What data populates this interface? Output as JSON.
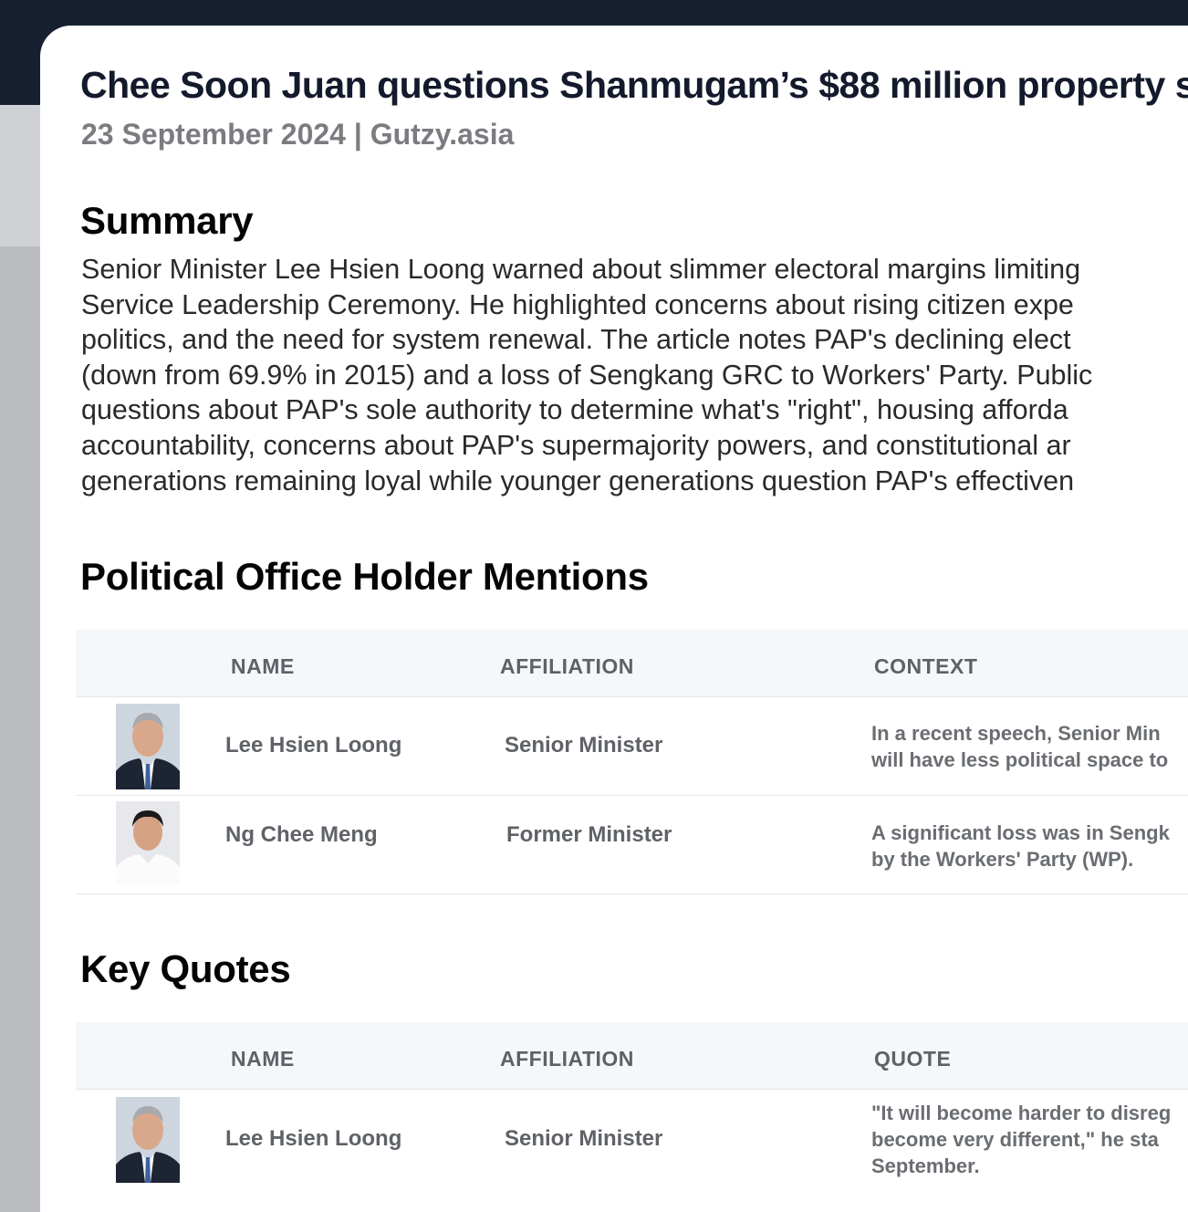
{
  "article": {
    "title": "Chee Soon Juan questions Shanmugam’s $88 million property s",
    "meta": "23 September 2024 | Gutzy.asia"
  },
  "summary": {
    "heading": "Summary",
    "lines": [
      "Senior Minister Lee Hsien Loong warned about slimmer electoral margins limiting",
      "Service Leadership Ceremony. He highlighted concerns about rising citizen expe",
      "politics, and the need for system renewal. The article notes PAP's declining elect",
      "(down from 69.9% in 2015) and a loss of Sengkang GRC to Workers' Party. Public",
      "questions about PAP's sole authority to determine what's \"right\", housing afforda",
      "accountability, concerns about PAP's supermajority powers, and constitutional ar",
      "generations remaining loyal while younger generations question PAP's effectiven"
    ]
  },
  "mentions": {
    "heading": "Political Office Holder Mentions",
    "columns": {
      "name": "NAME",
      "affiliation": "AFFILIATION",
      "context": "CONTEXT"
    },
    "rows": [
      {
        "name": "Lee Hsien Loong",
        "affiliation": "Senior Minister",
        "context_lines": [
          "In a recent speech, Senior Min",
          "will have less political space to"
        ]
      },
      {
        "name": "Ng Chee Meng",
        "affiliation": "Former Minister",
        "context_lines": [
          "A significant loss was in Sengk",
          "by the Workers' Party (WP)."
        ]
      }
    ]
  },
  "quotes": {
    "heading": "Key Quotes",
    "columns": {
      "name": "NAME",
      "affiliation": "AFFILIATION",
      "quote": "QUOTE"
    },
    "rows": [
      {
        "name": "Lee Hsien Loong",
        "affiliation": "Senior Minister",
        "quote_lines": [
          "\"It will become harder to disreg",
          "become very different,\" he sta",
          "September."
        ]
      }
    ]
  },
  "colors": {
    "topbar": "#162030",
    "title": "#131a2b",
    "meta": "#7a7c80",
    "table_header_bg": "#f6f7f9"
  }
}
